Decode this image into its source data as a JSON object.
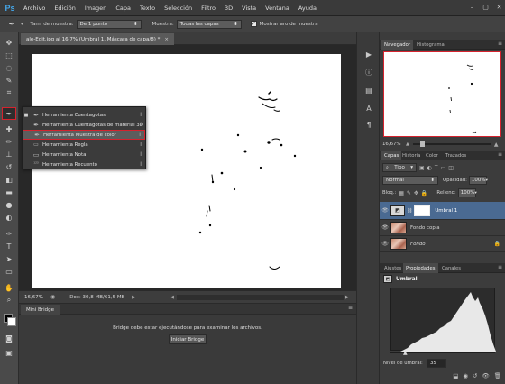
{
  "app": {
    "logo": "Ps"
  },
  "menubar": {
    "items": [
      "Archivo",
      "Edición",
      "Imagen",
      "Capa",
      "Texto",
      "Selección",
      "Filtro",
      "3D",
      "Vista",
      "Ventana",
      "Ayuda"
    ],
    "window_controls": [
      "–",
      "▢",
      "✕"
    ]
  },
  "options_bar": {
    "sample_size_label": "Tam. de muestra:",
    "sample_size_value": "De 1 punto",
    "sample_label": "Muestra:",
    "sample_value": "Todas las capas",
    "show_ring_label": "Mostrar aro de muestra",
    "show_ring_checked": true
  },
  "document": {
    "tab_title": "ale-Edit.jpg al 16,7% (Umbral 1, Máscara de capa/8) *",
    "tab_close": "×"
  },
  "statusbar": {
    "zoom": "16,67%",
    "doc_info": "Doc: 30,8 MB/61,5 MB"
  },
  "mini_bridge": {
    "tab_label": "Mini Bridge",
    "message": "Bridge debe estar ejecutándose para examinar los archivos.",
    "button_label": "Iniciar Bridge"
  },
  "tool_flyout": {
    "items": [
      {
        "label": "Herramienta Cuentagotas",
        "key": "I",
        "icon": "eyedropper-icon",
        "glyph": "✒",
        "selected": true,
        "highlighted": false
      },
      {
        "label": "Herramienta Cuentagotas de material 3D",
        "key": "I",
        "icon": "eyedropper-3d-icon",
        "glyph": "✒",
        "selected": false,
        "highlighted": false
      },
      {
        "label": "Herramienta Muestra de color",
        "key": "I",
        "icon": "color-sampler-icon",
        "glyph": "✒",
        "selected": false,
        "highlighted": true
      },
      {
        "label": "Herramienta Regla",
        "key": "I",
        "icon": "ruler-icon",
        "glyph": "📏",
        "selected": false,
        "highlighted": false
      },
      {
        "label": "Herramienta Nota",
        "key": "I",
        "icon": "note-icon",
        "glyph": "▭",
        "selected": false,
        "highlighted": false
      },
      {
        "label": "Herramienta Recuento",
        "key": "I",
        "icon": "count-icon",
        "glyph": "¹²³",
        "selected": false,
        "highlighted": false
      }
    ]
  },
  "navigator": {
    "tabs": [
      "Navegador",
      "Histograma"
    ],
    "active_tab": 0,
    "zoom": "16,67%"
  },
  "layers_panel": {
    "tabs": [
      "Capas",
      "Historia",
      "Color",
      "Trazados"
    ],
    "active_tab": 0,
    "filter_label": "Tipo",
    "blend_mode": "Normal",
    "opacity_label": "Opacidad:",
    "opacity_value": "100%",
    "lock_label": "Bloq.:",
    "fill_label": "Relleno:",
    "fill_value": "100%",
    "layers": [
      {
        "name": "Umbral 1",
        "kind": "adjustment",
        "selected": true
      },
      {
        "name": "Fondo copia",
        "kind": "photo",
        "selected": false
      },
      {
        "name": "Fondo",
        "kind": "photo",
        "selected": false,
        "locked": true
      }
    ]
  },
  "properties_panel": {
    "tabs": [
      "Ajustes",
      "Propiedades",
      "Canales"
    ],
    "active_tab": 1,
    "adjustment_name": "Umbral",
    "threshold_label": "Nivel de umbral:",
    "threshold_value": "35"
  },
  "colors": {
    "highlight_red": "#d5232e",
    "selected_blue": "#4a6a92"
  }
}
